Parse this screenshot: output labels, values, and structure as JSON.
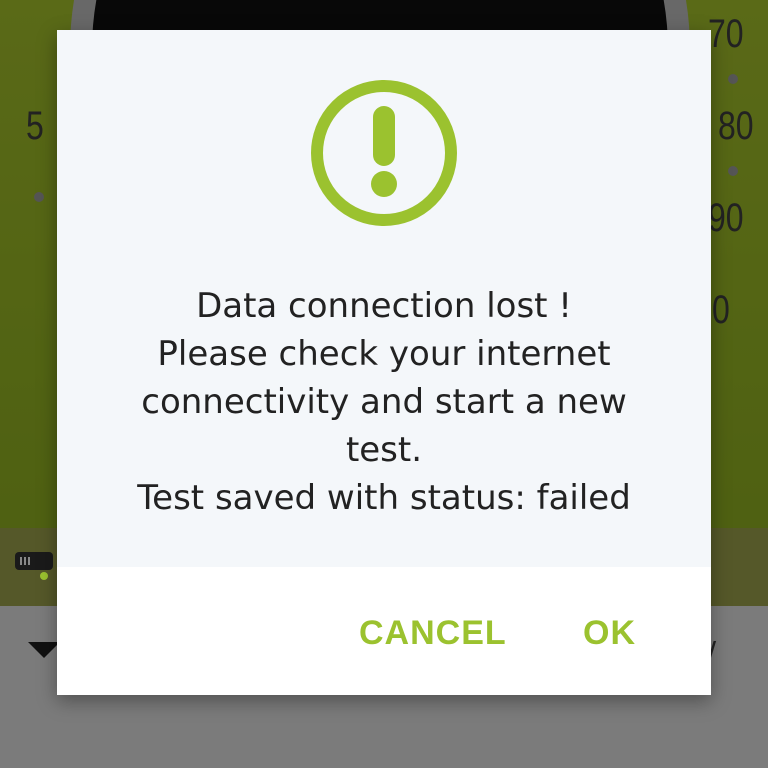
{
  "background": {
    "gauge_labels": [
      "70",
      "80",
      "90",
      "0",
      "5"
    ]
  },
  "dialog": {
    "message_lines": [
      "Data connection lost !",
      "Please check your internet",
      "connectivity and start a new",
      "test.",
      "Test saved with status: failed"
    ],
    "icon": "exclamation-circle-icon",
    "accent_color": "#9bc22f",
    "cancel_label": "CANCEL",
    "ok_label": "OK"
  }
}
